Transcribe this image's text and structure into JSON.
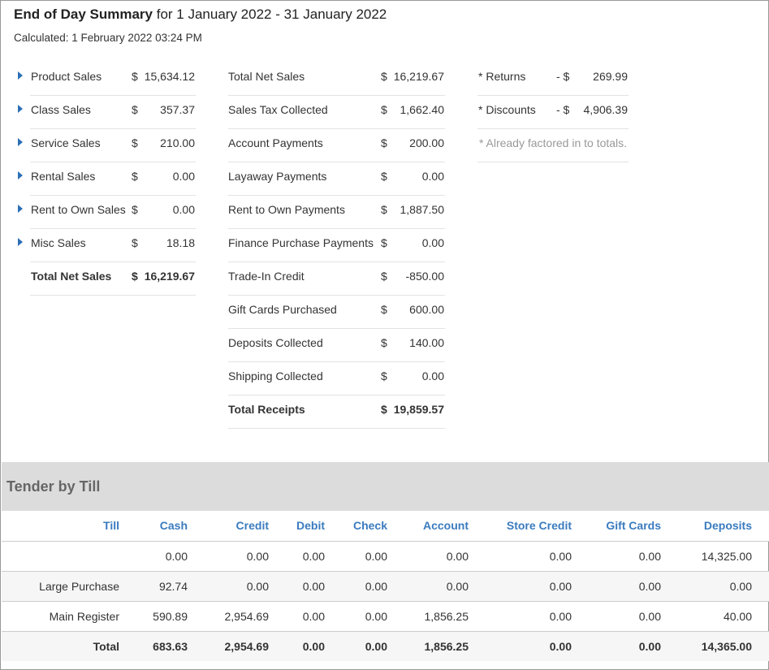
{
  "header": {
    "title": "End of Day Summary",
    "range": "for 1 January 2022 - 31 January 2022",
    "calculated": "Calculated: 1 February 2022 03:24 PM"
  },
  "sales": [
    {
      "label": "Product Sales",
      "cur": "$",
      "amount": "15,634.12"
    },
    {
      "label": "Class Sales",
      "cur": "$",
      "amount": "357.37"
    },
    {
      "label": "Service Sales",
      "cur": "$",
      "amount": "210.00"
    },
    {
      "label": "Rental Sales",
      "cur": "$",
      "amount": "0.00"
    },
    {
      "label": "Rent to Own Sales",
      "cur": "$",
      "amount": "0.00"
    },
    {
      "label": "Misc Sales",
      "cur": "$",
      "amount": "18.18"
    }
  ],
  "sales_total": {
    "label": "Total Net Sales",
    "cur": "$",
    "amount": "16,219.67"
  },
  "receipts": [
    {
      "label": "Total Net Sales",
      "cur": "$",
      "amount": "16,219.67"
    },
    {
      "label": "Sales Tax Collected",
      "cur": "$",
      "amount": "1,662.40"
    },
    {
      "label": "Account Payments",
      "cur": "$",
      "amount": "200.00"
    },
    {
      "label": "Layaway Payments",
      "cur": "$",
      "amount": "0.00"
    },
    {
      "label": "Rent to Own Payments",
      "cur": "$",
      "amount": "1,887.50"
    },
    {
      "label": "Finance Purchase Payments",
      "cur": "$",
      "amount": "0.00"
    },
    {
      "label": "Trade-In Credit",
      "cur": "$",
      "amount": "-850.00"
    },
    {
      "label": "Gift Cards Purchased",
      "cur": "$",
      "amount": "600.00"
    },
    {
      "label": "Deposits Collected",
      "cur": "$",
      "amount": "140.00"
    },
    {
      "label": "Shipping Collected",
      "cur": "$",
      "amount": "0.00"
    }
  ],
  "receipts_total": {
    "label": "Total Receipts",
    "cur": "$",
    "amount": "19,859.57"
  },
  "adjustments": [
    {
      "label": "* Returns",
      "cur": "- $",
      "amount": "269.99"
    },
    {
      "label": "* Discounts",
      "cur": "- $",
      "amount": "4,906.39"
    }
  ],
  "adjust_note": "* Already factored in to totals.",
  "tender": {
    "title": "Tender by Till",
    "columns": [
      "Till",
      "Cash",
      "Credit",
      "Debit",
      "Check",
      "Account",
      "Store Credit",
      "Gift Cards",
      "Deposits"
    ],
    "rows": [
      [
        "",
        "0.00",
        "0.00",
        "0.00",
        "0.00",
        "0.00",
        "0.00",
        "0.00",
        "14,325.00"
      ],
      [
        "Large Purchase",
        "92.74",
        "0.00",
        "0.00",
        "0.00",
        "0.00",
        "0.00",
        "0.00",
        "0.00"
      ],
      [
        "Main Register",
        "590.89",
        "2,954.69",
        "0.00",
        "0.00",
        "1,856.25",
        "0.00",
        "0.00",
        "40.00"
      ]
    ],
    "total": [
      "Total",
      "683.63",
      "2,954.69",
      "0.00",
      "0.00",
      "1,856.25",
      "0.00",
      "0.00",
      "14,365.00"
    ]
  },
  "colors": {
    "link": "#3a7bbf",
    "caret": "#2b6fb6",
    "band": "#dcdcdc"
  }
}
